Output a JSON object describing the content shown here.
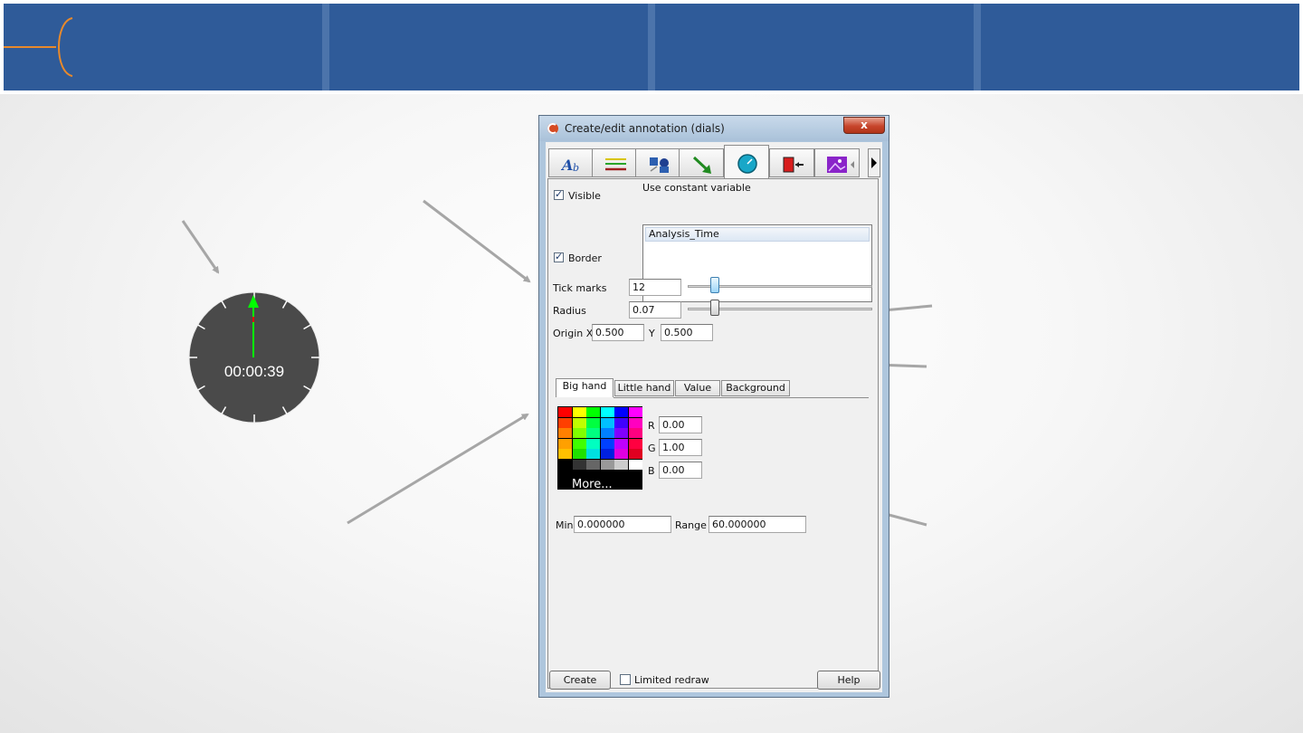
{
  "dialog": {
    "title": "Create/edit annotation (dials)",
    "close_label": "x",
    "tabs": [
      {
        "icon": "text-annotation-icon"
      },
      {
        "icon": "line-annotation-icon"
      },
      {
        "icon": "shapes-annotation-icon"
      },
      {
        "icon": "arrow-annotation-icon"
      },
      {
        "icon": "dial-annotation-icon",
        "active": true
      },
      {
        "icon": "legend-annotation-icon"
      },
      {
        "icon": "image-annotation-icon"
      }
    ],
    "visible_label": "Visible",
    "border_label": "Border",
    "constant_variable_label": "Use constant variable",
    "constant_variables": [
      "Analysis_Time"
    ],
    "tick_marks_label": "Tick marks",
    "tick_marks_value": "12",
    "tick_marks_slider_fraction": 0.13,
    "radius_label": "Radius",
    "radius_value": "0.07",
    "radius_slider_fraction": 0.13,
    "origin_x_label": "Origin X",
    "origin_x_value": "0.500",
    "origin_y_label": "Y",
    "origin_y_value": "0.500",
    "subtabs": [
      "Big hand",
      "Little hand",
      "Value",
      "Background"
    ],
    "active_subtab": "Big hand",
    "r_label": "R",
    "r_value": "0.00",
    "g_label": "G",
    "g_value": "1.00",
    "b_label": "B",
    "b_value": "0.00",
    "more_label": "More...",
    "min_label": "Min",
    "min_value": "0.000000",
    "range_label": "Range",
    "range_value": "60.000000",
    "create_label": "Create",
    "limited_redraw_label": "Limited redraw",
    "help_label": "Help"
  },
  "dial_preview": {
    "time_text": "00:00:39",
    "face_color": "#4a4a4a",
    "big_hand_color": "#00ff00",
    "little_hand_color": "#ff0000"
  },
  "palette_colors": [
    [
      "#ff0000",
      "#ffff00",
      "#00ff00",
      "#00ffff",
      "#0000ff",
      "#ff00ff"
    ],
    [
      "#ff4000",
      "#c0ff00",
      "#00ff40",
      "#00c0ff",
      "#4000ff",
      "#ff00c0"
    ],
    [
      "#ff8000",
      "#80ff00",
      "#00ff80",
      "#0080ff",
      "#8000ff",
      "#ff0080"
    ],
    [
      "#ffa000",
      "#40ff00",
      "#00ffc0",
      "#0040ff",
      "#c000ff",
      "#ff0040"
    ],
    [
      "#ffc000",
      "#20e000",
      "#00e0e0",
      "#0020e0",
      "#e000e0",
      "#e00020"
    ],
    [
      "#000000",
      "#333333",
      "#666666",
      "#999999",
      "#cccccc",
      "#ffffff"
    ]
  ],
  "colors": {
    "header_blue": "#2f5b99",
    "accent_orange": "#e8892b",
    "arrow_gray": "#a6a6a6"
  }
}
